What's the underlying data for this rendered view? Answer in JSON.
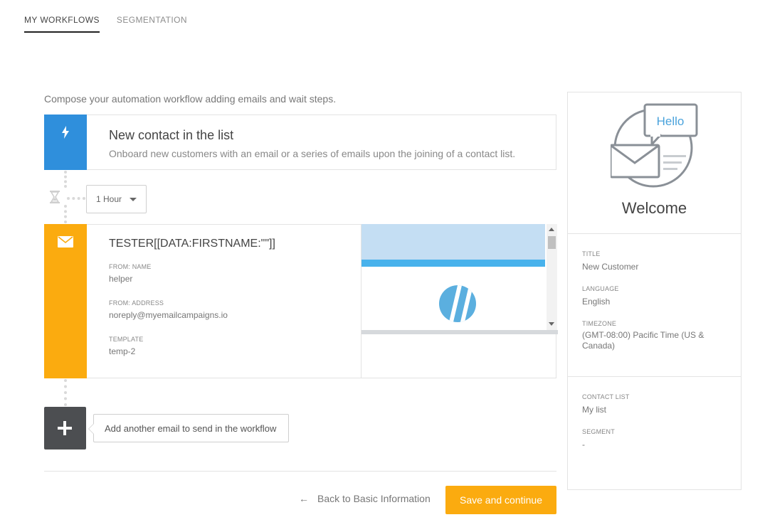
{
  "tabs": [
    {
      "label": "MY WORKFLOWS",
      "active": true
    },
    {
      "label": "SEGMENTATION",
      "active": false
    }
  ],
  "intro": "Compose your automation workflow adding emails and wait steps.",
  "trigger": {
    "icon": "lightning-bolt-icon",
    "title": "New contact in the list",
    "description": "Onboard new customers with an email or a series of emails upon the joining of a contact list.",
    "color": "#2f8fdc"
  },
  "wait": {
    "icon": "hourglass-icon",
    "value": "1 Hour"
  },
  "email": {
    "icon": "envelope-icon",
    "color": "#fbab0f",
    "subject": "TESTER[[DATA:FIRSTNAME:\"\"]]",
    "from_name_label": "FROM: NAME",
    "from_name": "helper",
    "from_address_label": "FROM: ADDRESS",
    "from_address": "noreply@myemailcampaigns.io",
    "template_label": "TEMPLATE",
    "template": "temp-2"
  },
  "add_email": {
    "icon": "plus-icon",
    "label": "Add another email to send in the workflow"
  },
  "footer": {
    "back_label": "Back to Basic Information",
    "save_label": "Save and continue"
  },
  "sidebar": {
    "bubble_text": "Hello",
    "title": "Welcome",
    "title_label": "TITLE",
    "title_value": "New Customer",
    "language_label": "LANGUAGE",
    "language_value": "English",
    "timezone_label": "TIMEZONE",
    "timezone_value": "(GMT-08:00) Pacific Time (US & Canada)",
    "contact_list_label": "CONTACT LIST",
    "contact_list_value": "My list",
    "segment_label": "SEGMENT",
    "segment_value": "-"
  },
  "colors": {
    "accent": "#fbab0f",
    "trigger_blue": "#2f8fdc",
    "button_dark": "#4c4e51"
  }
}
